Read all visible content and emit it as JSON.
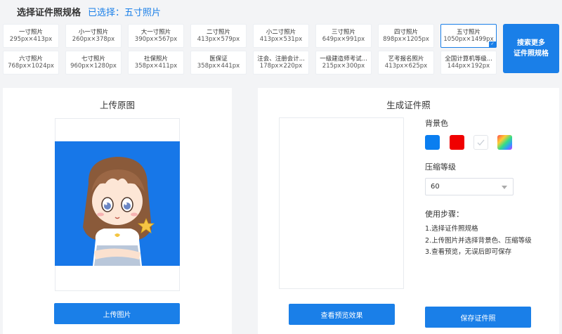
{
  "header": {
    "title": "选择证件照规格",
    "selected_label": "已选择：五寸照片"
  },
  "sizes": [
    {
      "name": "一寸照片",
      "dim": "295px×413px"
    },
    {
      "name": "小一寸照片",
      "dim": "260px×378px"
    },
    {
      "name": "大一寸照片",
      "dim": "390px×567px"
    },
    {
      "name": "二寸照片",
      "dim": "413px×579px"
    },
    {
      "name": "小二寸照片",
      "dim": "413px×531px"
    },
    {
      "name": "三寸照片",
      "dim": "649px×991px"
    },
    {
      "name": "四寸照片",
      "dim": "898px×1205px"
    },
    {
      "name": "五寸照片",
      "dim": "1050px×1499px"
    },
    {
      "name": "六寸照片",
      "dim": "768px×1024px"
    },
    {
      "name": "七寸照片",
      "dim": "960px×1280px"
    },
    {
      "name": "社保照片",
      "dim": "358px×411px"
    },
    {
      "name": "医保证",
      "dim": "358px×441px"
    },
    {
      "name": "注会、注册会计...",
      "dim": "178px×220px"
    },
    {
      "name": "一级建造师考试...",
      "dim": "215px×300px"
    },
    {
      "name": "艺考报名照片",
      "dim": "413px×625px"
    },
    {
      "name": "全国计算机等级...",
      "dim": "144px×192px"
    }
  ],
  "search_more": {
    "line1": "搜索更多",
    "line2": "证件照规格"
  },
  "upload_panel": {
    "title": "上传原图",
    "upload_button": "上传图片"
  },
  "generate_panel": {
    "title": "生成证件照",
    "bg_label": "背景色",
    "bg_colors": [
      "#0a7ef0",
      "#f00000",
      "#ffffff",
      "gradient"
    ],
    "compress_label": "压缩等级",
    "compress_value": "60",
    "steps_label": "使用步骤：",
    "steps": [
      "1.选择证件照规格",
      "2.上传图片并选择背景色、压缩等级",
      "3.查看预览，无误后即可保存"
    ],
    "preview_button": "查看预览效果",
    "save_button": "保存证件照"
  },
  "colors": {
    "accent": "#1a7fe8",
    "photo_bg": "#1777e8"
  }
}
